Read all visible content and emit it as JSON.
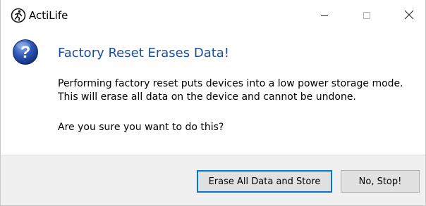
{
  "window": {
    "title": "ActiLife",
    "app_icon": "actilife-runner-icon",
    "controls": {
      "minimize_icon": "minimize-icon",
      "maximize_icon": "maximize-icon",
      "close_icon": "close-icon"
    }
  },
  "dialog": {
    "icon": "question-icon",
    "heading": "Factory Reset Erases Data!",
    "message_lines": [
      "Performing factory reset puts devices into a low power storage mode.",
      "This will erase all data on the device and cannot be undone."
    ],
    "question": "Are you sure you want to do this?"
  },
  "buttons": {
    "confirm_label": "Erase All Data and Store",
    "cancel_label": "No, Stop!"
  },
  "colors": {
    "heading": "#1a4fa0",
    "focus_border": "#0078d7",
    "footer_bg": "#f0f0f0",
    "button_bg": "#e1e1e1"
  }
}
